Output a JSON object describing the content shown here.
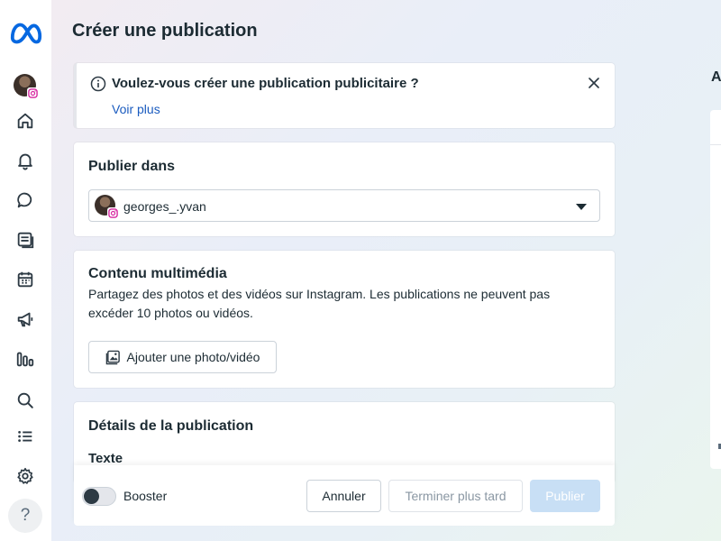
{
  "sidebar": {
    "logo_icon": "meta-logo-icon",
    "items": [
      {
        "icon": "home-icon"
      },
      {
        "icon": "bell-icon"
      },
      {
        "icon": "chat-bubble-icon"
      },
      {
        "icon": "content-icon"
      },
      {
        "icon": "calendar-icon"
      },
      {
        "icon": "megaphone-icon"
      },
      {
        "icon": "insights-icon"
      },
      {
        "icon": "search-icon"
      },
      {
        "icon": "list-icon"
      },
      {
        "icon": "gear-icon"
      }
    ],
    "help_label": "?"
  },
  "page": {
    "title": "Créer une publication"
  },
  "notice": {
    "title": "Voulez-vous créer une publication publicitaire ?",
    "link": "Voir plus"
  },
  "publish": {
    "title": "Publier dans",
    "account": "georges_.yvan"
  },
  "media": {
    "title": "Contenu multimédia",
    "description": "Partagez des photos et des vidéos sur Instagram. Les publications ne peuvent pas excéder 10 photos ou vidéos.",
    "add_button": "Ajouter une photo/vidéo"
  },
  "details": {
    "title": "Détails de la publication",
    "text_label": "Texte"
  },
  "footer": {
    "booster_label": "Booster",
    "booster_on": false,
    "cancel": "Annuler",
    "later": "Terminer plus tard",
    "publish": "Publier"
  },
  "right_panel": {
    "heading_fragment": "A"
  },
  "colors": {
    "accent": "#1a5bbf",
    "publish_disabled": "#c8dff5",
    "text": "#1c2b33",
    "meta_blue": "#0668e1"
  }
}
